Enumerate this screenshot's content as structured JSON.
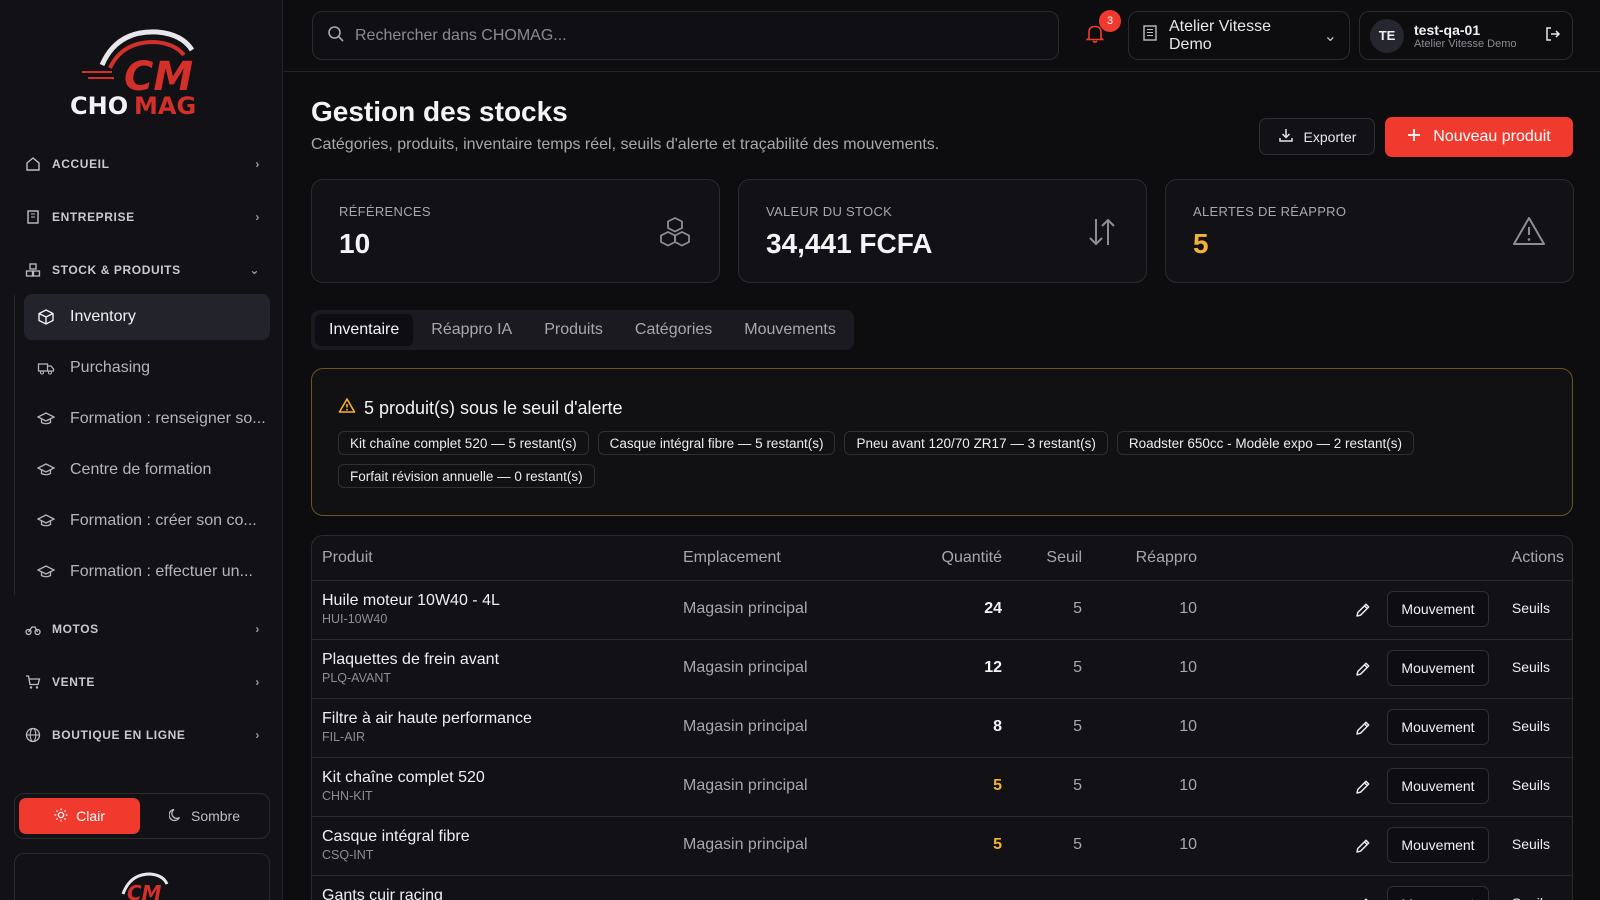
{
  "sidebar": {
    "sections": [
      {
        "label": "ACCUEIL",
        "icon": "home-icon"
      },
      {
        "label": "ENTREPRISE",
        "icon": "building-icon"
      },
      {
        "label": "STOCK & PRODUITS",
        "icon": "boxes-icon"
      },
      {
        "label": "MOTOS",
        "icon": "motorcycle-icon"
      },
      {
        "label": "VENTE",
        "icon": "cart-icon"
      },
      {
        "label": "BOUTIQUE EN LIGNE",
        "icon": "globe-icon"
      }
    ],
    "items": [
      {
        "label": "Inventory",
        "icon": "package-icon",
        "active": true
      },
      {
        "label": "Purchasing",
        "icon": "truck-icon"
      },
      {
        "label": "Formation : renseigner so...",
        "icon": "graduation-cap-icon"
      },
      {
        "label": "Centre de formation",
        "icon": "graduation-cap-icon"
      },
      {
        "label": "Formation : créer son co...",
        "icon": "graduation-cap-icon"
      },
      {
        "label": "Formation : effectuer un...",
        "icon": "graduation-cap-icon"
      }
    ],
    "theme": {
      "light": "Clair",
      "dark": "Sombre",
      "selected": "Clair"
    }
  },
  "topbar": {
    "search_placeholder": "Rechercher dans CHOMAG...",
    "notifications": "3",
    "org": "Atelier Vitesse Demo",
    "user": {
      "initials": "TE",
      "name": "test-qa-01",
      "org": "Atelier Vitesse Demo"
    }
  },
  "page": {
    "title": "Gestion des stocks",
    "subtitle": "Catégories, produits, inventaire temps réel, seuils d'alerte et traçabilité des mouvements.",
    "export_label": "Exporter",
    "new_label": "Nouveau produit"
  },
  "stats": [
    {
      "label": "RÉFÉRENCES",
      "value": "10"
    },
    {
      "label": "VALEUR DU STOCK",
      "value": "34,441 FCFA"
    },
    {
      "label": "ALERTES DE RÉAPPRO",
      "value": "5"
    }
  ],
  "tabs": [
    "Inventaire",
    "Réappro IA",
    "Produits",
    "Catégories",
    "Mouvements"
  ],
  "alert": {
    "title": "5 produit(s) sous le seuil d'alerte",
    "chips": [
      "Kit chaîne complet 520 — 5 restant(s)",
      "Casque intégral fibre — 5 restant(s)",
      "Pneu avant 120/70 ZR17 — 3 restant(s)",
      "Roadster 650cc - Modèle expo — 2 restant(s)",
      "Forfait révision annuelle — 0 restant(s)"
    ]
  },
  "table": {
    "headers": {
      "product": "Produit",
      "location": "Emplacement",
      "qty": "Quantité",
      "threshold": "Seuil",
      "reorder": "Réappro",
      "actions": "Actions"
    },
    "move_label": "Mouvement",
    "thresholds_label": "Seuils",
    "rows": [
      {
        "name": "Huile moteur 10W40 - 4L",
        "sku": "HUI-10W40",
        "location": "Magasin principal",
        "qty": "24",
        "threshold": "5",
        "reorder": "10"
      },
      {
        "name": "Plaquettes de frein avant",
        "sku": "PLQ-AVANT",
        "location": "Magasin principal",
        "qty": "12",
        "threshold": "5",
        "reorder": "10"
      },
      {
        "name": "Filtre à air haute performance",
        "sku": "FIL-AIR",
        "location": "Magasin principal",
        "qty": "8",
        "threshold": "5",
        "reorder": "10"
      },
      {
        "name": "Kit chaîne complet 520",
        "sku": "CHN-KIT",
        "location": "Magasin principal",
        "qty": "5",
        "threshold": "5",
        "reorder": "10"
      },
      {
        "name": "Casque intégral fibre",
        "sku": "CSQ-INT",
        "location": "Magasin principal",
        "qty": "5",
        "threshold": "5",
        "reorder": "10"
      },
      {
        "name": "Gants cuir racing",
        "sku": "",
        "location": "",
        "qty": "",
        "threshold": "",
        "reorder": ""
      }
    ]
  },
  "colors": {
    "accent": "#f03a2e",
    "warning": "#f5b335",
    "background": "#0d0d10"
  }
}
